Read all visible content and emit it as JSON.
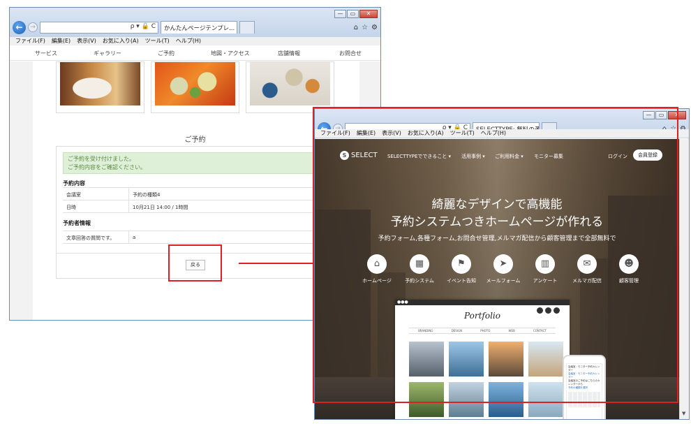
{
  "win1": {
    "tab_title": "かんたんページテンプレ...",
    "addr_glyphs": "ρ ▾ 🔒 C",
    "menu": [
      "ファイル(F)",
      "編集(E)",
      "表示(V)",
      "お気に入り(A)",
      "ツール(T)",
      "ヘルプ(H)"
    ],
    "site_nav": [
      "サービス",
      "ギャラリー",
      "ご予約",
      "地図・アクセス",
      "店舗情報",
      "お問合せ"
    ],
    "heading": "ご予約",
    "alert_line1": "ご予約を受け付けました。",
    "alert_line2": "ご予約内容をご確認ください。",
    "section1": "予約内容",
    "rows1": [
      {
        "k": "会議室",
        "v": "予約の種類4"
      },
      {
        "k": "日時",
        "v": "10月21日 14:00 / 1時間"
      }
    ],
    "section2": "予約者情報",
    "rows2": [
      {
        "k": "文章回答の質問です。",
        "v": "a"
      }
    ],
    "back_button": "戻る"
  },
  "win2": {
    "tab_title": "SELECTTYPE: 無料の予...",
    "addr_glyphs": "ρ ▾ 🔒 C",
    "menu": [
      "ファイル(F)",
      "編集(E)",
      "表示(V)",
      "お気に入り(A)",
      "ツール(T)",
      "ヘルプ(H)"
    ],
    "logo": "SELECT",
    "nav": [
      "SELECTTYPEでできること ▾",
      "活用事例 ▾",
      "ご利用料金 ▾",
      "モニター募集"
    ],
    "login": "ログイン",
    "register": "会員登録",
    "headline1": "綺麗なデザインで高機能",
    "headline2": "予約システムつきホームページが作れる",
    "subline": "予約フォーム,各種フォーム,お問合せ管理,メルマガ配信から顧客管理まで全部無料で",
    "features": [
      {
        "label": "ホームページ",
        "icon": "⌂"
      },
      {
        "label": "予約システム",
        "icon": "▦"
      },
      {
        "label": "イベント告知",
        "icon": "⚑"
      },
      {
        "label": "メールフォーム",
        "icon": "➤"
      },
      {
        "label": "アンケート",
        "icon": "▥"
      },
      {
        "label": "メルマガ配信",
        "icon": "✉"
      },
      {
        "label": "顧客管理",
        "icon": "☻"
      }
    ],
    "portfolio_title": "Portfolio",
    "portfolio_menu": [
      "BRANDING",
      "DESIGN",
      "PHOTO",
      "WEB",
      "CONTACT"
    ],
    "phone_lines": [
      "会議室・モニター予約カレンダー",
      "会議室 · モニター予約カレンダー",
      "会議室のご予約はこちらのカレンダーから",
      "予約の種類を選択"
    ]
  }
}
